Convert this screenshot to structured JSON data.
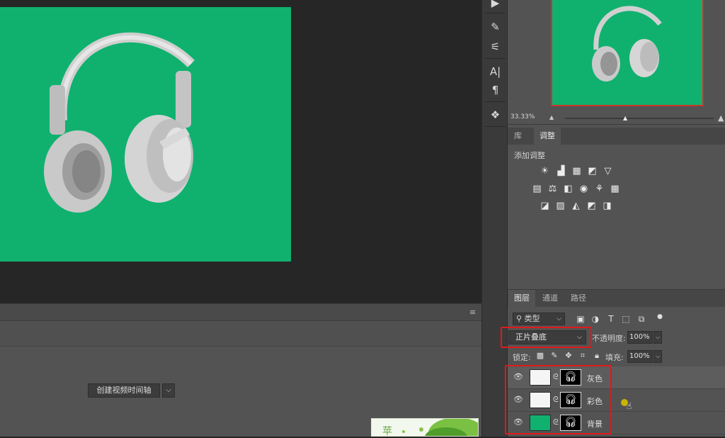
{
  "timeline": {
    "create_button": "创建视频时间轴",
    "dropdown_arrow": "⌵",
    "panel_menu": "≡"
  },
  "navigator": {
    "zoom": "33.33%"
  },
  "adjustments_panel": {
    "tabs": [
      {
        "label": "库",
        "active": false
      },
      {
        "label": "调整",
        "active": true
      }
    ],
    "title": "添加调整"
  },
  "layers_panel": {
    "tabs": [
      {
        "label": "图层",
        "active": true
      },
      {
        "label": "通道",
        "active": false
      },
      {
        "label": "路径",
        "active": false
      }
    ],
    "filter_kind": "类型",
    "blend_mode": "正片叠底",
    "opacity_label": "不透明度:",
    "opacity_value": "100%",
    "lock_label": "锁定:",
    "fill_label": "填充:",
    "fill_value": "100%",
    "layers": [
      {
        "name": "灰色",
        "thumb_color": "#f5f5f5",
        "selected": true
      },
      {
        "name": "彩色",
        "thumb_color": "#f5f5f5",
        "selected": false
      },
      {
        "name": "背景",
        "thumb_color": "#10b16f",
        "selected": false
      }
    ]
  },
  "colors": {
    "canvas_green": "#10b16f",
    "highlight_red": "#e11919"
  },
  "ad": {
    "text": "苹"
  }
}
